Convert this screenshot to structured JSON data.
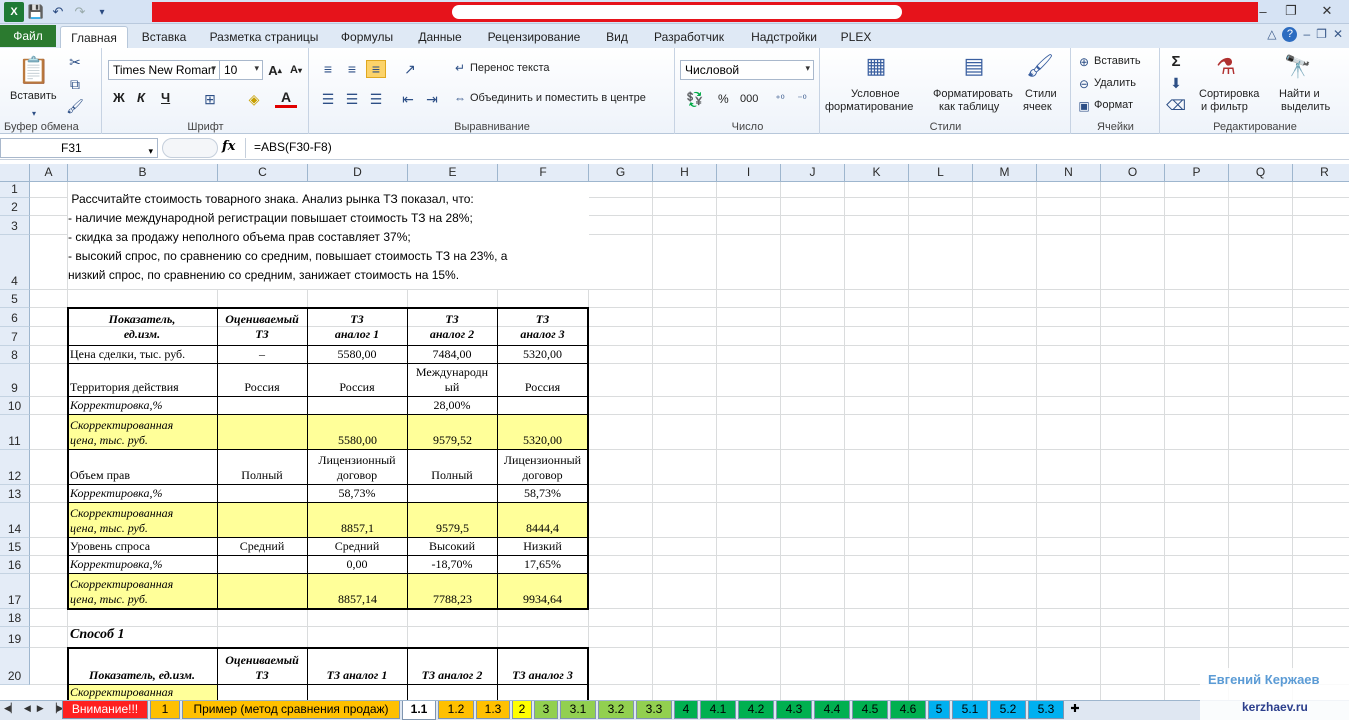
{
  "app": {
    "title": ""
  },
  "tabs": {
    "file": "Файл",
    "items": [
      "Главная",
      "Вставка",
      "Разметка страницы",
      "Формулы",
      "Данные",
      "Рецензирование",
      "Вид",
      "Разработчик",
      "Надстройки",
      "PLEX"
    ]
  },
  "ribbon": {
    "clipboard": {
      "label": "Буфер обмена",
      "paste": "Вставить"
    },
    "font": {
      "label": "Шрифт",
      "name": "Times New Roman",
      "size": "10",
      "bold": "Ж",
      "italic": "К",
      "underline": "Ч"
    },
    "alignment": {
      "label": "Выравнивание",
      "wrap": "Перенос текста",
      "merge": "Объединить и поместить в центре"
    },
    "number": {
      "label": "Число",
      "format": "Числовой",
      "percent": "%",
      "thousands": "000"
    },
    "styles": {
      "label": "Стили",
      "conditional_1": "Условное",
      "conditional_2": "форматирование",
      "table_1": "Форматировать",
      "table_2": "как таблицу",
      "cell_1": "Стили",
      "cell_2": "ячеек"
    },
    "cells": {
      "label": "Ячейки",
      "insert": "Вставить",
      "delete": "Удалить",
      "format": "Формат"
    },
    "editing": {
      "label": "Редактирование",
      "sort_1": "Сортировка",
      "sort_2": "и фильтр",
      "find_1": "Найти и",
      "find_2": "выделить"
    }
  },
  "formula_bar": {
    "name_box": "F31",
    "fx": "fx",
    "formula": "=ABS(F30-F8)"
  },
  "columns": [
    "A",
    "B",
    "C",
    "D",
    "E",
    "F",
    "G",
    "H",
    "I",
    "J",
    "K",
    "L",
    "M",
    "N",
    "O",
    "P",
    "Q",
    "R"
  ],
  "rows": [
    "1",
    "2",
    "3",
    "4",
    "5",
    "6",
    "7",
    "8",
    "9",
    "10",
    "11",
    "12",
    "13",
    "14",
    "15",
    "16",
    "17",
    "18",
    "19",
    "20"
  ],
  "note_text": " Рассчитайте стоимость товарного знака. Анализ рынка ТЗ показал, что:\n- наличие международной регистрации повышает стоимость ТЗ на 28%;\n- скидка за продажу неполного объема прав составляет 37%;\n- высокий спрос, по сравнению со средним, повышает стоимость ТЗ на 23%, а\nнизкий спрос, по сравнению со средним, занижает стоимость на 15%.",
  "table1": {
    "header": {
      "b": "Показатель,\nед.изм.",
      "c": "Оцениваемый\nТЗ",
      "d": "ТЗ\nаналог 1",
      "e": "ТЗ\nаналог 2",
      "f": "ТЗ\nаналог 3"
    },
    "r8": {
      "b": "Цена сделки, тыс. руб.",
      "c": "–",
      "d": "5580,00",
      "e": "7484,00",
      "f": "5320,00"
    },
    "r9": {
      "b": "Территория действия",
      "c": "Россия",
      "d": "Россия",
      "e": "Международн\nый",
      "f": "Россия"
    },
    "r10": {
      "b": "Корректировка,%",
      "c": "",
      "d": "",
      "e": "28,00%",
      "f": ""
    },
    "r11": {
      "b": "Скорректированная\nцена, тыс. руб.",
      "c": "",
      "d": "5580,00",
      "e": "9579,52",
      "f": "5320,00"
    },
    "r12": {
      "b": "Объем прав",
      "c": "Полный",
      "d": "Лицензионный\nдоговор",
      "e": "Полный",
      "f": "Лицензионный\nдоговор"
    },
    "r13": {
      "b": "Корректировка,%",
      "c": "",
      "d": "58,73%",
      "e": "",
      "f": "58,73%"
    },
    "r14": {
      "b": "Скорректированная\nцена, тыс. руб.",
      "c": "",
      "d": "8857,1",
      "e": "9579,5",
      "f": "8444,4"
    },
    "r15": {
      "b": "Уровень спроса",
      "c": "Средний",
      "d": "Средний",
      "e": "Высокий",
      "f": "Низкий"
    },
    "r16": {
      "b": "Корректировка,%",
      "c": "",
      "d": "0,00",
      "e": "-18,70%",
      "f": "17,65%"
    },
    "r17": {
      "b": "Скорректированная\nцена, тыс. руб.",
      "c": "",
      "d": "8857,14",
      "e": "7788,23",
      "f": "9934,64"
    }
  },
  "sposob_title": "Способ 1",
  "table2": {
    "header": {
      "b": "Показатель, ед.изм.",
      "c": "Оцениваемый\nТЗ",
      "d": "ТЗ аналог 1",
      "e": "ТЗ аналог 2",
      "f": "ТЗ аналог 3"
    },
    "r21": {
      "b": "Скорректированная"
    }
  },
  "sheets": [
    {
      "label": "Внимание!!!",
      "color": "#ff2020",
      "text": "#ffffff"
    },
    {
      "label": "1",
      "color": "#ffc000",
      "text": "#000000"
    },
    {
      "label": "Пример (метод сравнения продаж)",
      "color": "#ffc000",
      "text": "#000000"
    },
    {
      "label": "1.1",
      "color": "#ffffff",
      "text": "#000000"
    },
    {
      "label": "1.2",
      "color": "#ffc000",
      "text": "#000000"
    },
    {
      "label": "1.3",
      "color": "#ffc000",
      "text": "#000000"
    },
    {
      "label": "2",
      "color": "#ffff00",
      "text": "#000000"
    },
    {
      "label": "3",
      "color": "#92d050",
      "text": "#000000"
    },
    {
      "label": "3.1",
      "color": "#92d050",
      "text": "#000000"
    },
    {
      "label": "3.2",
      "color": "#92d050",
      "text": "#000000"
    },
    {
      "label": "3.3",
      "color": "#92d050",
      "text": "#000000"
    },
    {
      "label": "4",
      "color": "#00b050",
      "text": "#000000"
    },
    {
      "label": "4.1",
      "color": "#00b050",
      "text": "#000000"
    },
    {
      "label": "4.2",
      "color": "#00b050",
      "text": "#000000"
    },
    {
      "label": "4.3",
      "color": "#00b050",
      "text": "#000000"
    },
    {
      "label": "4.4",
      "color": "#00b050",
      "text": "#000000"
    },
    {
      "label": "4.5",
      "color": "#00b050",
      "text": "#000000"
    },
    {
      "label": "4.6",
      "color": "#00b050",
      "text": "#000000"
    },
    {
      "label": "5",
      "color": "#00b0f0",
      "text": "#000000"
    },
    {
      "label": "5.1",
      "color": "#00b0f0",
      "text": "#000000"
    },
    {
      "label": "5.2",
      "color": "#00b0f0",
      "text": "#000000"
    },
    {
      "label": "5.3",
      "color": "#00b0f0",
      "text": "#000000"
    }
  ],
  "watermark": {
    "name": "Евгений Кержаев",
    "site": "kerzhaev.ru"
  },
  "colors": {
    "title_band": "#e6131b",
    "file_tab": "#2b7a2f",
    "highlight": "#ffff99"
  }
}
